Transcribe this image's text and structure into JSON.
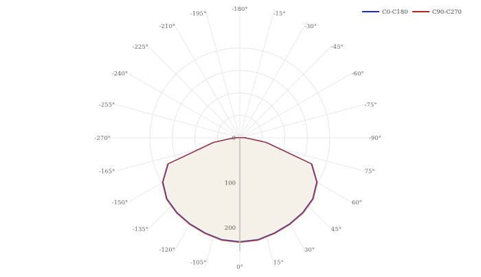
{
  "chart_data": {
    "type": "polar-line",
    "angle_ticks": [
      "0°",
      "15°",
      "30°",
      "45°",
      "60°",
      "75°",
      "-90°",
      "-75°",
      "-60°",
      "-45°",
      "-30°",
      "-15°",
      "-180°",
      "-195°",
      "-210°",
      "-225°",
      "-240°",
      "-255°",
      "-270°",
      "-165°",
      "-150°",
      "-135°",
      "-120°",
      "-105°"
    ],
    "radial_ticks": [
      "0",
      "100",
      "200"
    ],
    "r_max": 300,
    "legend_position": "top-right",
    "series": [
      {
        "name": "C0-C180",
        "color": "#1f2a9c",
        "angles": [
          0,
          10,
          20,
          30,
          40,
          50,
          60,
          70,
          80,
          85,
          88,
          90,
          92,
          95,
          100,
          270,
          265,
          268,
          272,
          275,
          280,
          290,
          300,
          310,
          320,
          330,
          340,
          350,
          360
        ],
        "values": [
          232,
          231,
          226,
          222,
          218,
          212,
          198,
          170,
          60,
          22,
          14,
          14,
          8,
          5,
          0,
          0,
          5,
          8,
          14,
          22,
          60,
          170,
          198,
          212,
          218,
          222,
          226,
          231,
          232
        ]
      },
      {
        "name": "C90-C270",
        "color": "#b8231f",
        "angles": [
          0,
          10,
          20,
          30,
          40,
          50,
          60,
          70,
          80,
          85,
          88,
          90,
          92,
          95,
          100,
          270,
          265,
          268,
          272,
          275,
          280,
          290,
          300,
          310,
          320,
          330,
          340,
          350,
          360
        ],
        "values": [
          232,
          231,
          226,
          222,
          218,
          212,
          198,
          170,
          60,
          22,
          14,
          14,
          8,
          5,
          0,
          0,
          5,
          8,
          14,
          22,
          60,
          170,
          198,
          212,
          218,
          222,
          226,
          231,
          232
        ]
      }
    ]
  }
}
